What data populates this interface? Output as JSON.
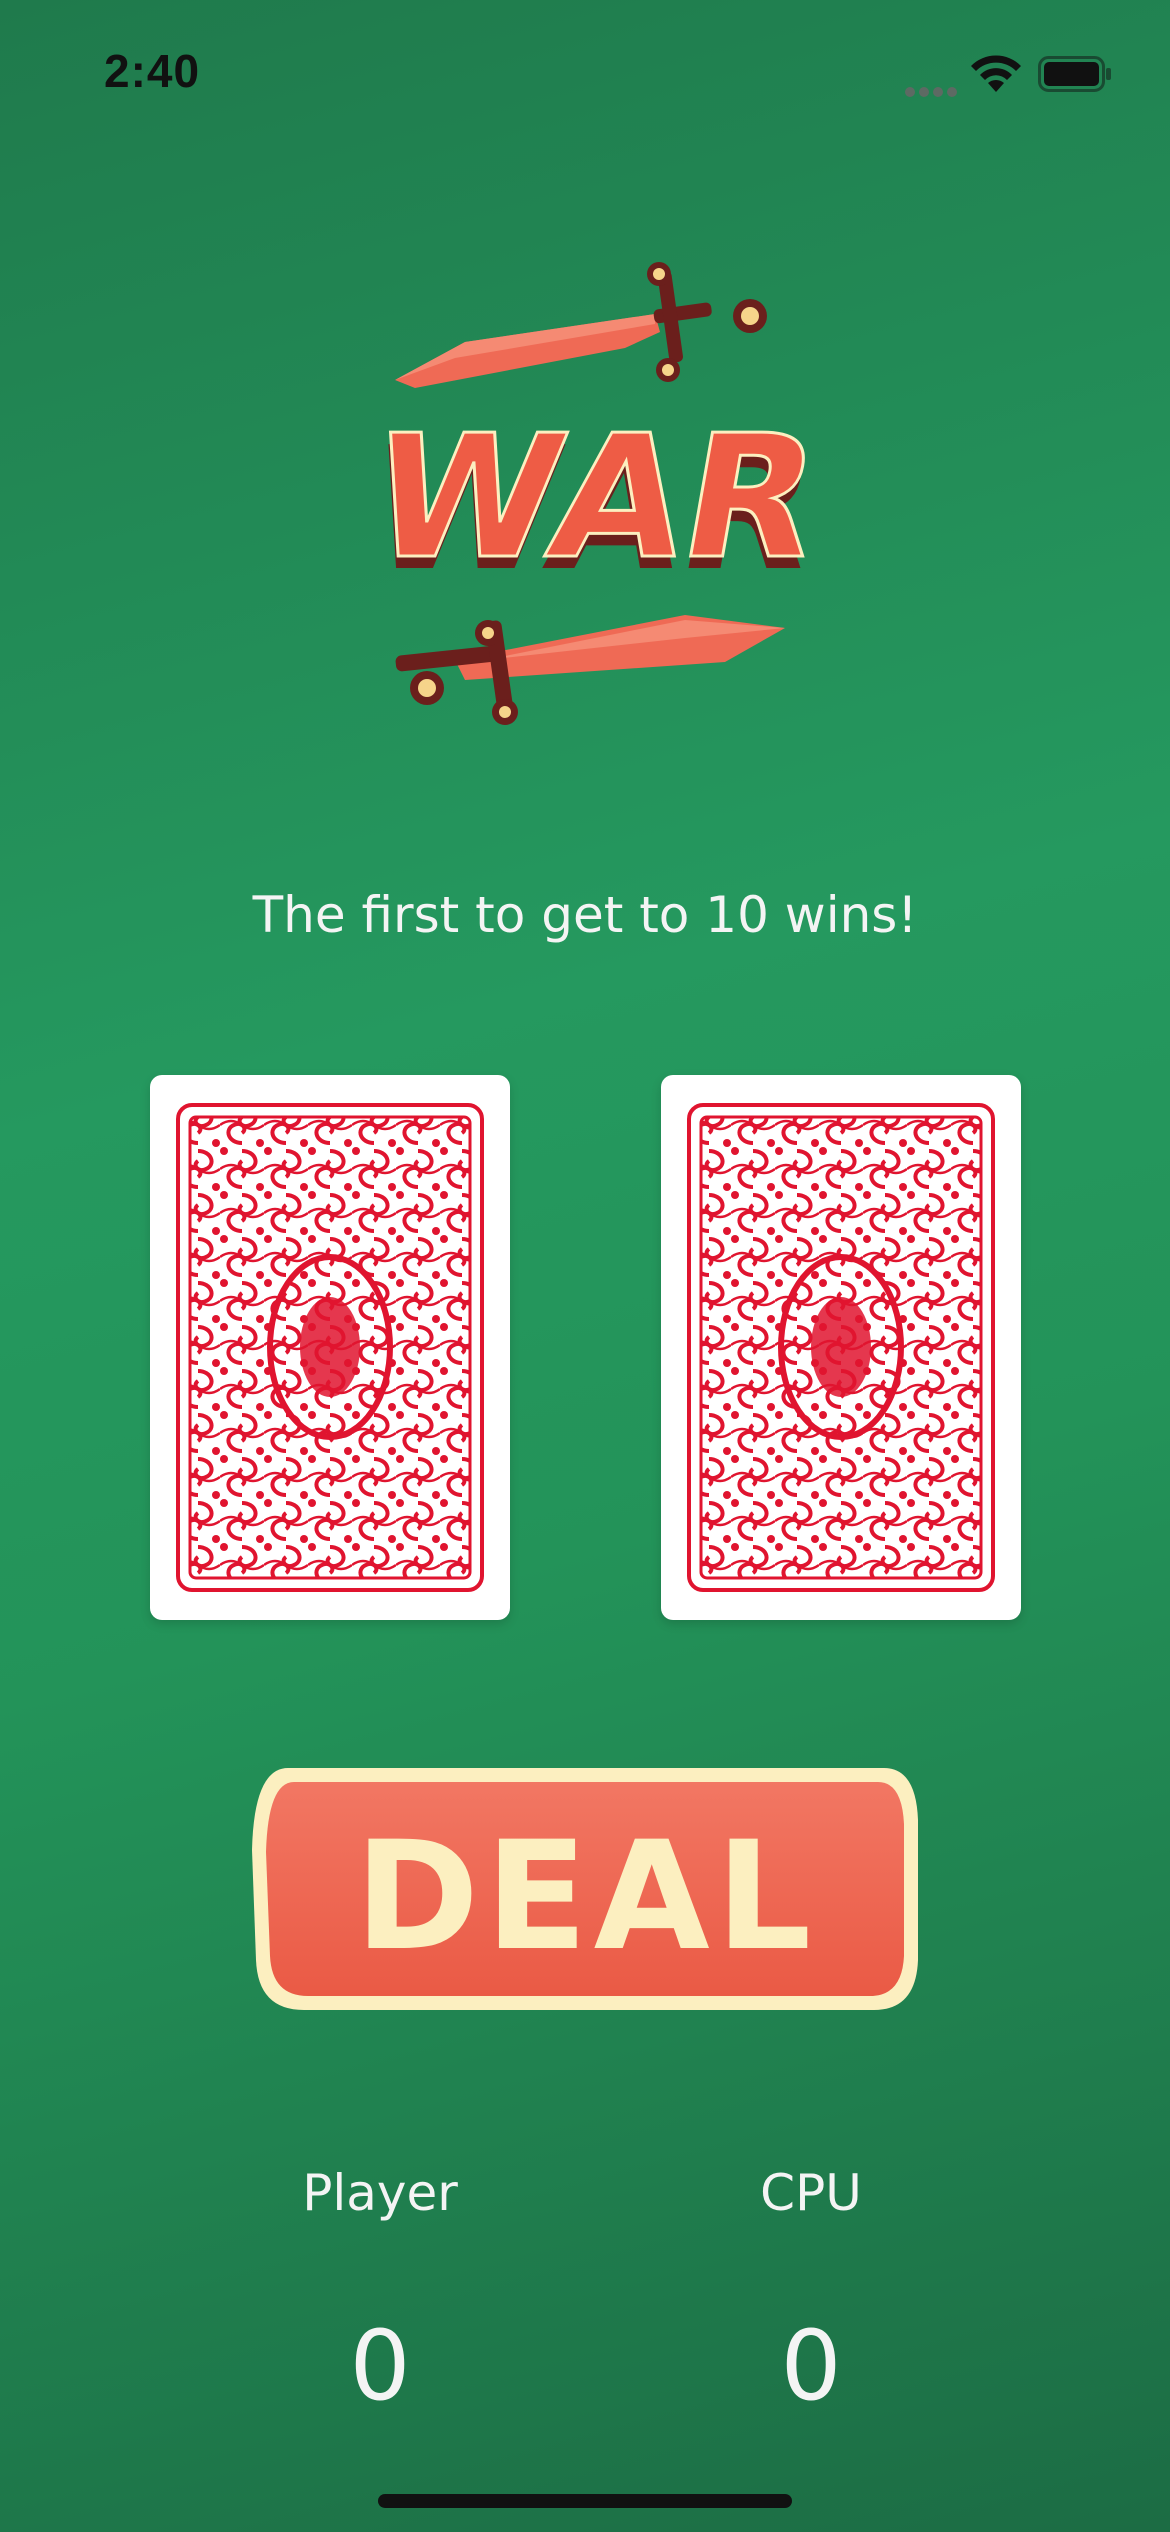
{
  "status_bar": {
    "time": "2:40"
  },
  "logo": {
    "text": "WAR"
  },
  "tagline": "The first to get to 10 wins!",
  "deal_button": {
    "label": "DEAL"
  },
  "scores": {
    "player": {
      "label": "Player",
      "value": "0"
    },
    "cpu": {
      "label": "CPU",
      "value": "0"
    }
  },
  "icons": {
    "wifi": "wifi-icon",
    "battery": "battery-icon",
    "card_back": "card-back-pattern"
  },
  "colors": {
    "background": "#25995f",
    "accent_red": "#ee5c45",
    "cream": "#fcefc0",
    "card_red": "#e0142f"
  }
}
